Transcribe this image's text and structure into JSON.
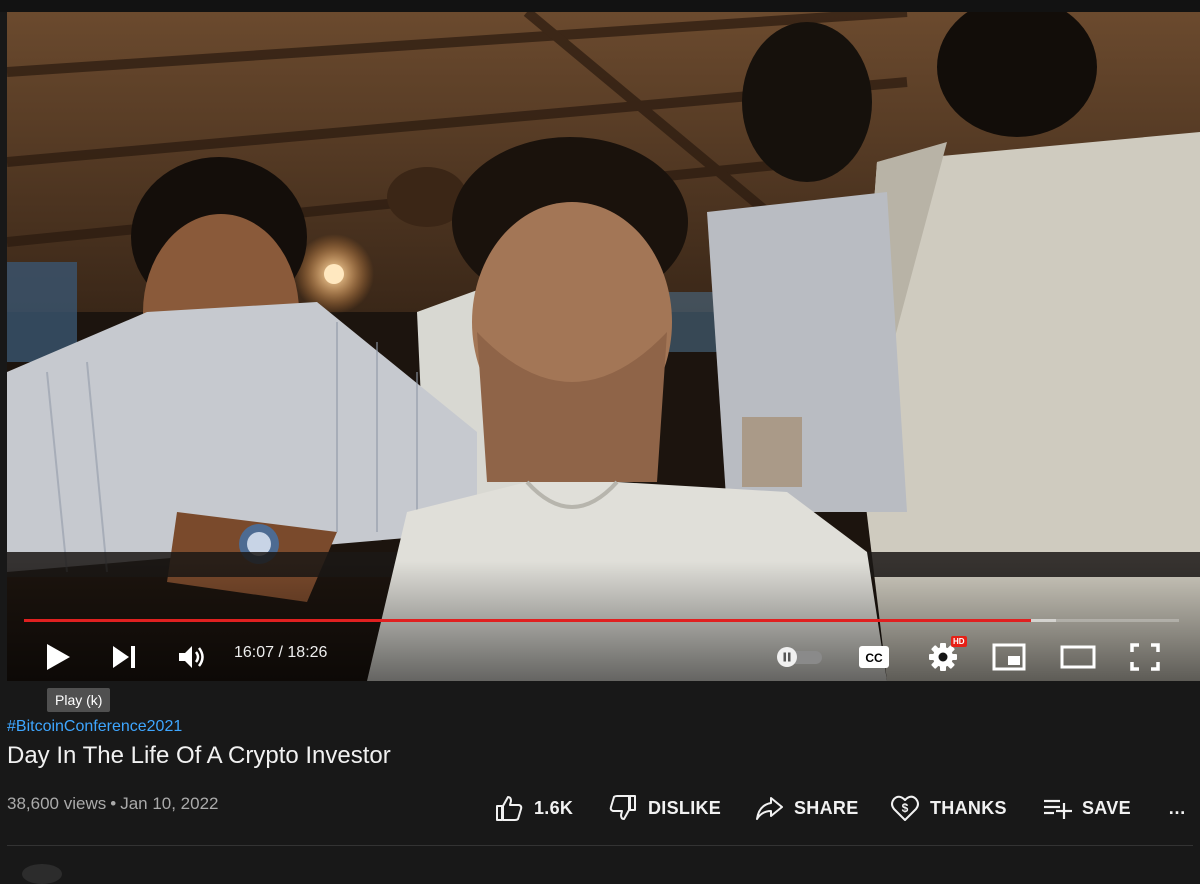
{
  "player": {
    "time_current": "16:07",
    "time_separator": " / ",
    "time_total": "18:26",
    "progress_played": 0.8715,
    "progress_loaded": 0.8939,
    "tooltip": "Play (k)",
    "hd_badge": "HD",
    "cc_label": "CC",
    "icons": [
      "play-icon",
      "next-icon",
      "volume-icon",
      "autoplay-toggle",
      "captions-icon",
      "settings-icon",
      "miniplayer-icon",
      "theater-icon",
      "fullscreen-icon"
    ]
  },
  "video": {
    "hashtag": "#BitcoinConference2021",
    "title": "Day In The Life Of A Crypto Investor",
    "views": "38,600 views",
    "date_sep": "•",
    "date": "Jan 10, 2022"
  },
  "actions": {
    "like": "1.6K",
    "dislike": "DISLIKE",
    "share": "SHARE",
    "thanks": "THANKS",
    "save": "SAVE",
    "more": "…"
  },
  "colors": {
    "background": "#181818",
    "progress_played": "#e02020",
    "hashtag": "#3ea6ff",
    "hd_badge": "#e62117"
  }
}
